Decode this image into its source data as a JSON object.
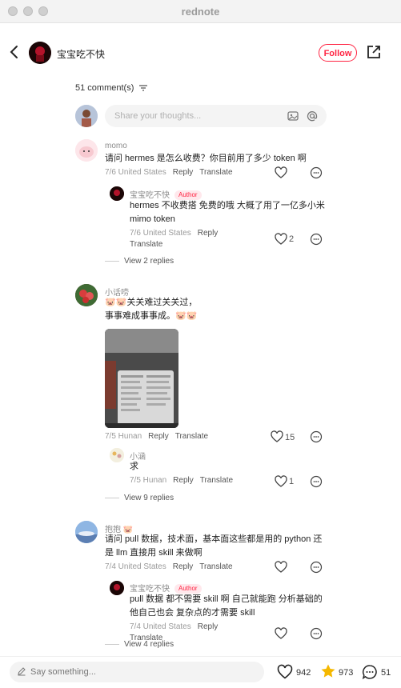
{
  "app": {
    "title": "rednote"
  },
  "post": {
    "author": "宝宝吃不快",
    "follow_label": "Follow"
  },
  "comments_header": {
    "count_label": "51 comment(s)",
    "input_placeholder": "Share your thoughts..."
  },
  "comments": [
    {
      "name": "momo",
      "text": "请问 hermes 是怎么收费？你目前用了多少 token 啊",
      "date_loc": "7/6 United States",
      "reply": "Reply",
      "translate": "Translate",
      "likes": "",
      "replies": [
        {
          "name": "宝宝吃不快",
          "badge": "Author",
          "text_line1": "hermes 不收费搭 免费的哦 大概了用了一亿多小米",
          "text_line2": "mimo token",
          "date_loc": "7/6 United States",
          "reply": "Reply",
          "translate": "Translate",
          "likes": "2"
        }
      ],
      "view_more": "View 2 replies"
    },
    {
      "name": "小话唠",
      "text_line1": "🐷🐷关关难过关关过，",
      "text_line2": "事事难成事事成。🐷🐷",
      "date_loc": "7/5 Hunan",
      "reply": "Reply",
      "translate": "Translate",
      "likes": "15",
      "replies": [
        {
          "name": "小涵",
          "text": "求",
          "date_loc": "7/5 Hunan",
          "reply": "Reply",
          "translate": "Translate",
          "likes": "1"
        }
      ],
      "view_more": "View 9 replies"
    },
    {
      "name": "抱抱 🐷",
      "text_line1": "请问 pull 数据，技术面，基本面这些都是用的 python 还",
      "text_line2": "是 llm 直接用 skill 来做啊",
      "date_loc": "7/4 United States",
      "reply": "Reply",
      "translate": "Translate",
      "likes": "",
      "replies": [
        {
          "name": "宝宝吃不快",
          "badge": "Author",
          "text_line1": "pull 数据 都不需要 skill 啊 自己就能跑 分析基础的",
          "text_line2": "他自己也会 复杂点的才需要 skill",
          "date_loc": "7/4 United States",
          "reply": "Reply",
          "translate": "Translate",
          "likes": ""
        }
      ],
      "view_more": "View 4 replies"
    }
  ],
  "bottom_bar": {
    "placeholder": "Say something...",
    "likes": "942",
    "stars": "973",
    "comments": "51"
  },
  "colors": {
    "accent": "#ff2442",
    "star": "#f5b800"
  }
}
